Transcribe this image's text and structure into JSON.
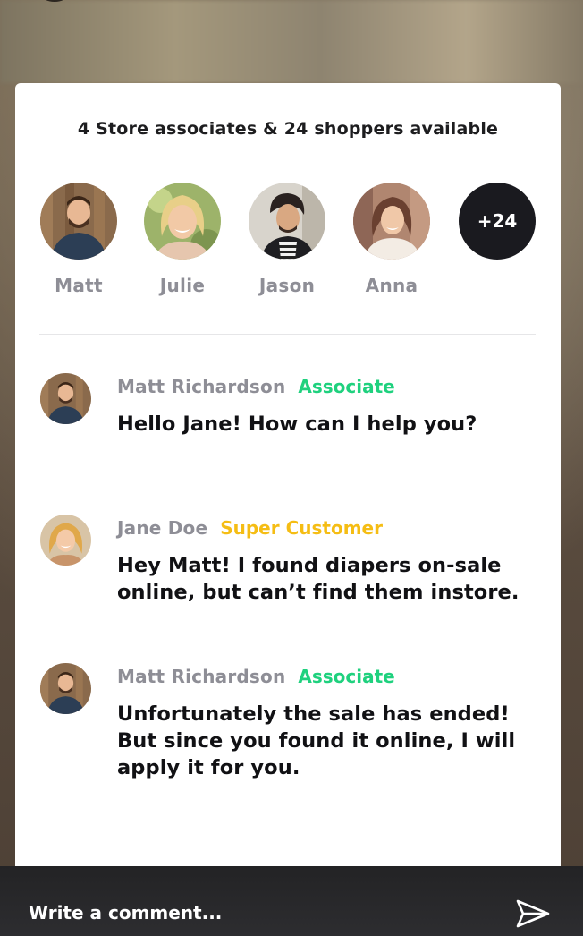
{
  "header": {
    "title": "4 Store associates & 24 shoppers available"
  },
  "agents": [
    {
      "name": "Matt"
    },
    {
      "name": "Julie"
    },
    {
      "name": "Jason"
    },
    {
      "name": "Anna"
    }
  ],
  "more_count": "+24",
  "messages": [
    {
      "author": "Matt Richardson",
      "role": "Associate",
      "role_color": "#1fd17e",
      "text": "Hello Jane! How can I help you?"
    },
    {
      "author": "Jane Doe",
      "role": "Super Customer",
      "role_color": "#f5bd14",
      "text": "Hey Matt! I found diapers on-sale online, but can’t find them instore."
    },
    {
      "author": "Matt Richardson",
      "role": "Associate",
      "role_color": "#1fd17e",
      "text": "Unfortunately the sale has ended! But since you found it online, I will apply it for you."
    }
  ],
  "composer": {
    "placeholder": "Write a comment..."
  },
  "colors": {
    "associate": "#1fd17e",
    "super_customer": "#f5bd14",
    "more_badge": "#1a1a1f"
  }
}
